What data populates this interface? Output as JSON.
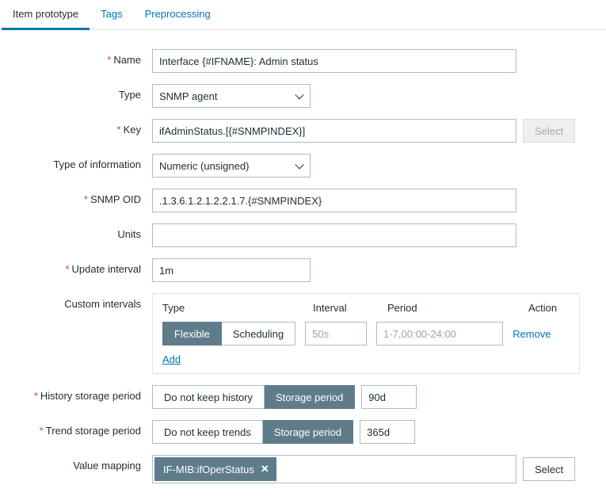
{
  "tabs": {
    "item_prototype": "Item prototype",
    "tags": "Tags",
    "preprocessing": "Preprocessing"
  },
  "labels": {
    "name": "Name",
    "type": "Type",
    "key": "Key",
    "type_of_info": "Type of information",
    "snmp_oid": "SNMP OID",
    "units": "Units",
    "update_interval": "Update interval",
    "custom_intervals": "Custom intervals",
    "history_storage": "History storage period",
    "trend_storage": "Trend storage period",
    "value_mapping": "Value mapping"
  },
  "values": {
    "name": "Interface {#IFNAME}: Admin status",
    "type": "SNMP agent",
    "key": "ifAdminStatus.[{#SNMPINDEX}]",
    "type_of_info": "Numeric (unsigned)",
    "snmp_oid": ".1.3.6.1.2.1.2.2.1.7.{#SNMPINDEX}",
    "units": "",
    "update_interval": "1m",
    "history_value": "90d",
    "trend_value": "365d",
    "value_mapping_tag": "IF-MIB:ifOperStatus"
  },
  "buttons": {
    "select": "Select"
  },
  "custom_intervals": {
    "head_type": "Type",
    "head_interval": "Interval",
    "head_period": "Period",
    "head_action": "Action",
    "flexible": "Flexible",
    "scheduling": "Scheduling",
    "interval_ph": "50s",
    "period_ph": "1-7,00:00-24:00",
    "remove": "Remove",
    "add": "Add"
  },
  "history_seg": {
    "no_keep": "Do not keep history",
    "storage": "Storage period"
  },
  "trend_seg": {
    "no_keep": "Do not keep trends",
    "storage": "Storage period"
  }
}
